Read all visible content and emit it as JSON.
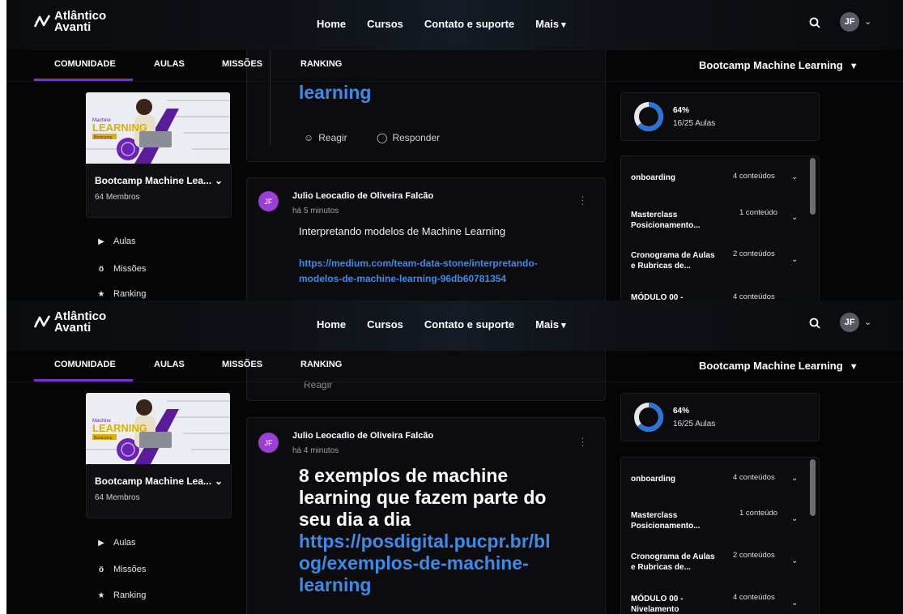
{
  "header": {
    "logo_line1": "Atlântico",
    "logo_line2": "Avanti",
    "nav": [
      "Home",
      "Cursos",
      "Contato e suporte",
      "Mais"
    ],
    "user_initials": "JF"
  },
  "tabs": [
    "COMUNIDADE",
    "AULAS",
    "MISSÕES",
    "RANKING"
  ],
  "active_tab": "COMUNIDADE",
  "bootcamp_select": "Bootcamp Machine Learning",
  "group": {
    "name": "Bootcamp Machine Lea...",
    "members": "64 Membros",
    "thumb_title_1": "Machine",
    "thumb_title_2": "LEARNING",
    "thumb_badge": "Bootcamp"
  },
  "sidebar_links": [
    {
      "label": "Aulas",
      "icon": "play-icon"
    },
    {
      "label": "Missões",
      "icon": "missions-icon"
    },
    {
      "label": "Ranking",
      "icon": "star-icon"
    }
  ],
  "progress": {
    "percent_label": "64%",
    "percent": 64,
    "lessons": "16/25 Aulas"
  },
  "modules": [
    {
      "title": [
        "onboarding"
      ],
      "count": "4 conteúdos"
    },
    {
      "title": [
        "Masterclass",
        "Posicionamento..."
      ],
      "count": "1 conteúdo"
    },
    {
      "title": [
        "Cronograma de Aulas",
        "e Rubricas de..."
      ],
      "count": "2 conteúdos"
    },
    {
      "title": [
        "MÓDULO 00 -",
        "Nivelamento"
      ],
      "count": "4 conteúdos"
    }
  ],
  "frame_top": {
    "prev_post_tail": "learning",
    "react_label": "Reagir",
    "reply_label": "Responder",
    "post": {
      "author": "Julio Leocadio de Oliveira Falcão",
      "time": "há 5 minutos",
      "initials": "JF",
      "text": "Interpretando modelos de Machine Learning",
      "link_line1": "https://medium.com/team-data-stone/interpretando-",
      "link_line2": "modelos-de-machine-learning-96db60781354"
    }
  },
  "frame_bottom": {
    "post": {
      "author": "Julio Leocadio de Oliveira Falcão",
      "time": "há 4 minutos",
      "initials": "JF",
      "text_lines": [
        "8 exemplos de machine",
        "learning que fazem parte do",
        "seu dia a dia"
      ],
      "link_lines": [
        "https://posdigital.pucpr.br/bl",
        "og/exemplos-de-machine-",
        "learning"
      ]
    }
  }
}
